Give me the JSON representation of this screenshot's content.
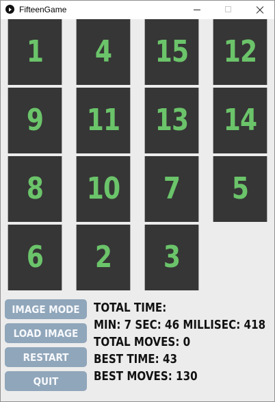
{
  "window": {
    "title": "FifteenGame"
  },
  "board": {
    "tiles": [
      "1",
      "4",
      "15",
      "12",
      "9",
      "11",
      "13",
      "14",
      "8",
      "10",
      "7",
      "5",
      "6",
      "2",
      "3"
    ],
    "tile_background": "#363636",
    "tile_text_color": "#6bc46a"
  },
  "controls": {
    "image_mode_label": "IMAGE MODE",
    "load_image_label": "LOAD IMAGE",
    "restart_label": "RESTART",
    "quit_label": "QUIT",
    "button_color": "#90a6ba"
  },
  "stats": {
    "total_time_label": "TOTAL TIME:",
    "time_value": "MIN: 7 SEC: 46 MILLISEC: 418",
    "total_moves_text": "TOTAL MOVES: 0",
    "best_time_text": "BEST TIME: 43",
    "best_moves_text": "BEST MOVES:  130"
  }
}
